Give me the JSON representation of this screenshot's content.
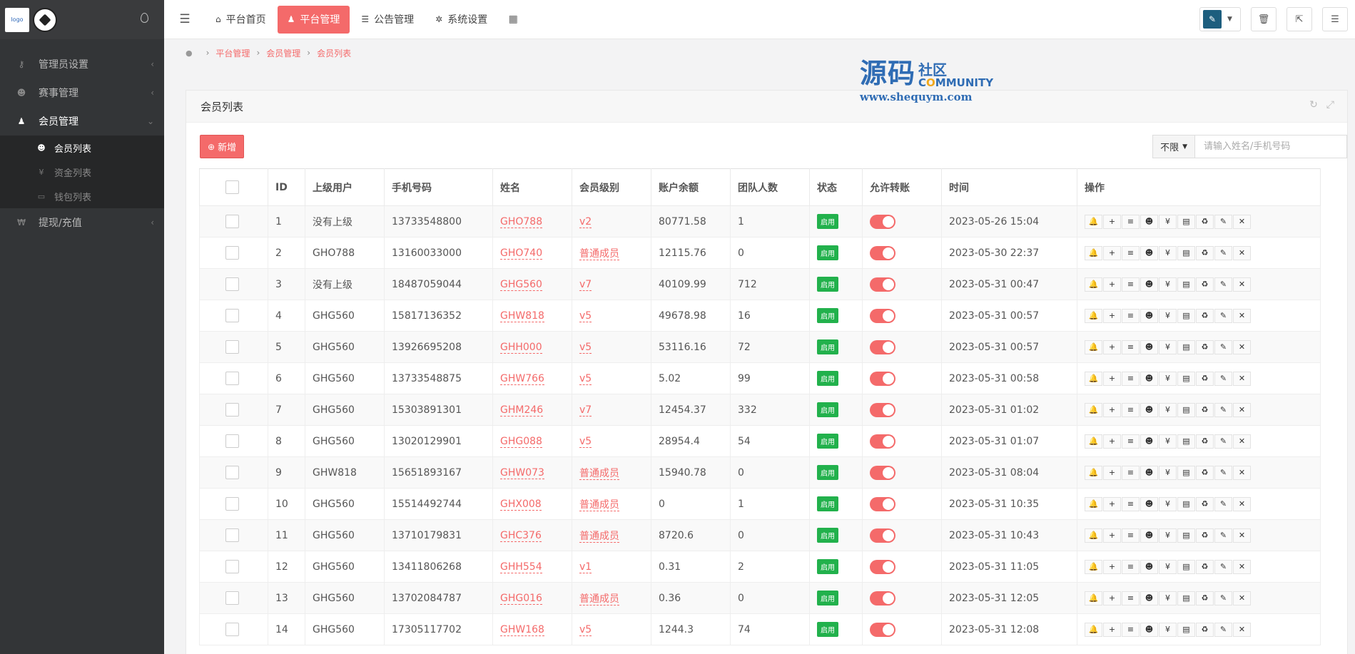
{
  "sidebar": {
    "logo_text": "logo",
    "items": [
      {
        "label": "管理员设置",
        "icon": "key-icon",
        "glyph": "⚷",
        "expanded": false
      },
      {
        "label": "赛事管理",
        "icon": "users-icon",
        "glyph": "☻",
        "expanded": false
      },
      {
        "label": "会员管理",
        "icon": "pin-icon",
        "glyph": "♟",
        "expanded": true,
        "children": [
          {
            "label": "会员列表",
            "icon": "users-icon",
            "glyph": "☻",
            "active": true
          },
          {
            "label": "资金列表",
            "icon": "yen-icon",
            "glyph": "¥",
            "active": false
          },
          {
            "label": "钱包列表",
            "icon": "card-icon",
            "glyph": "▭",
            "active": false
          }
        ]
      },
      {
        "label": "提现/充值",
        "icon": "won-icon",
        "glyph": "₩",
        "expanded": false
      }
    ]
  },
  "topbar": {
    "tabs": [
      {
        "label": "平台首页",
        "icon": "home-icon",
        "glyph": "⌂",
        "active": false
      },
      {
        "label": "平台管理",
        "icon": "user-icon",
        "glyph": "♟",
        "active": true
      },
      {
        "label": "公告管理",
        "icon": "list-icon",
        "glyph": "☰",
        "active": false
      },
      {
        "label": "系统设置",
        "icon": "gear-icon",
        "glyph": "✲",
        "active": false
      }
    ]
  },
  "breadcrumb": [
    "平台管理",
    "会员管理",
    "会员列表"
  ],
  "watermark": {
    "big": "源码",
    "she": "社区",
    "com": "COMMUNITY",
    "url": "www.shequym.com"
  },
  "panel": {
    "title": "会员列表",
    "add_label": "新增",
    "filter_label": "不限",
    "search_placeholder": "请输入姓名/手机号码"
  },
  "table": {
    "columns": [
      "ID",
      "上级用户",
      "手机号码",
      "姓名",
      "会员级别",
      "账户余额",
      "团队人数",
      "状态",
      "允许转账",
      "时间",
      "操作"
    ],
    "status_label": "启用",
    "ops": [
      "bell-icon",
      "plus-icon",
      "list-icon",
      "users-icon",
      "yen-icon",
      "card-icon",
      "recycle-icon",
      "pencil-icon",
      "close-icon"
    ],
    "ops_glyphs": [
      "🔔",
      "+",
      "≡",
      "☻",
      "¥",
      "▤",
      "♻",
      "✎",
      "✕"
    ],
    "rows": [
      {
        "id": "1",
        "parent": "没有上级",
        "phone": "13733548800",
        "name": "GHO788",
        "level": "v2",
        "balance": "80771.58",
        "team": "1",
        "time": "2023-05-26 15:04"
      },
      {
        "id": "2",
        "parent": "GHO788",
        "phone": "13160033000",
        "name": "GHO740",
        "level": "普通成员",
        "balance": "12115.76",
        "team": "0",
        "time": "2023-05-30 22:37"
      },
      {
        "id": "3",
        "parent": "没有上级",
        "phone": "18487059044",
        "name": "GHG560",
        "level": "v7",
        "balance": "40109.99",
        "team": "712",
        "time": "2023-05-31 00:47"
      },
      {
        "id": "4",
        "parent": "GHG560",
        "phone": "15817136352",
        "name": "GHW818",
        "level": "v5",
        "balance": "49678.98",
        "team": "16",
        "time": "2023-05-31 00:57"
      },
      {
        "id": "5",
        "parent": "GHG560",
        "phone": "13926695208",
        "name": "GHH000",
        "level": "v5",
        "balance": "53116.16",
        "team": "72",
        "time": "2023-05-31 00:57"
      },
      {
        "id": "6",
        "parent": "GHG560",
        "phone": "13733548875",
        "name": "GHW766",
        "level": "v5",
        "balance": "5.02",
        "team": "99",
        "time": "2023-05-31 00:58"
      },
      {
        "id": "7",
        "parent": "GHG560",
        "phone": "15303891301",
        "name": "GHM246",
        "level": "v7",
        "balance": "12454.37",
        "team": "332",
        "time": "2023-05-31 01:02"
      },
      {
        "id": "8",
        "parent": "GHG560",
        "phone": "13020129901",
        "name": "GHG088",
        "level": "v5",
        "balance": "28954.4",
        "team": "54",
        "time": "2023-05-31 01:07"
      },
      {
        "id": "9",
        "parent": "GHW818",
        "phone": "15651893167",
        "name": "GHW073",
        "level": "普通成员",
        "balance": "15940.78",
        "team": "0",
        "time": "2023-05-31 08:04"
      },
      {
        "id": "10",
        "parent": "GHG560",
        "phone": "15514492744",
        "name": "GHX008",
        "level": "普通成员",
        "balance": "0",
        "team": "1",
        "time": "2023-05-31 10:35"
      },
      {
        "id": "11",
        "parent": "GHG560",
        "phone": "13710179831",
        "name": "GHC376",
        "level": "普通成员",
        "balance": "8720.6",
        "team": "0",
        "time": "2023-05-31 10:43"
      },
      {
        "id": "12",
        "parent": "GHG560",
        "phone": "13411806268",
        "name": "GHH554",
        "level": "v1",
        "balance": "0.31",
        "team": "2",
        "time": "2023-05-31 11:05"
      },
      {
        "id": "13",
        "parent": "GHG560",
        "phone": "13702084787",
        "name": "GHG016",
        "level": "普通成员",
        "balance": "0.36",
        "team": "0",
        "time": "2023-05-31 12:05"
      },
      {
        "id": "14",
        "parent": "GHG560",
        "phone": "17305117702",
        "name": "GHW168",
        "level": "v5",
        "balance": "1244.3",
        "team": "74",
        "time": "2023-05-31 12:08"
      }
    ]
  }
}
